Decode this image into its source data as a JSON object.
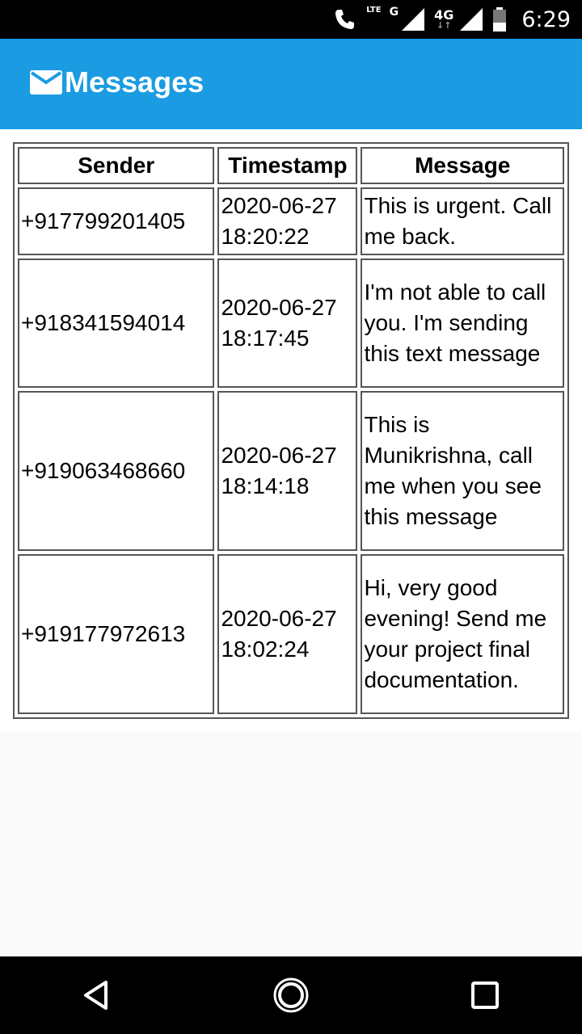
{
  "status_bar": {
    "lte_label": "LTE",
    "g_label": "G",
    "fourg_label": "4G",
    "fourg_arrows": "↓↑",
    "time": "6:29",
    "icons": [
      "phone-icon",
      "signal-icon",
      "battery-icon"
    ]
  },
  "app_bar": {
    "icon": "mail-icon",
    "title": "Messages",
    "color": "#1a9be2"
  },
  "table": {
    "headers": [
      "Sender",
      "Timestamp",
      "Message"
    ],
    "rows": [
      {
        "sender": "+917799201405",
        "date": "2020-06-27",
        "time": "18:20:22",
        "message": "This is urgent. Call me back."
      },
      {
        "sender": "+918341594014",
        "date": "2020-06-27",
        "time": "18:17:45",
        "message": "I'm not able to call you. I'm sending this text message"
      },
      {
        "sender": "+919063468660",
        "date": "2020-06-27",
        "time": "18:14:18",
        "message": "This is Munikrishna, call me when you see this message"
      },
      {
        "sender": "+919177972613",
        "date": "2020-06-27",
        "time": "18:02:24",
        "message": "Hi, very good evening! Send me your project final documentation."
      }
    ]
  },
  "nav_bar": {
    "buttons": [
      "back-icon",
      "home-icon",
      "recents-icon"
    ]
  }
}
